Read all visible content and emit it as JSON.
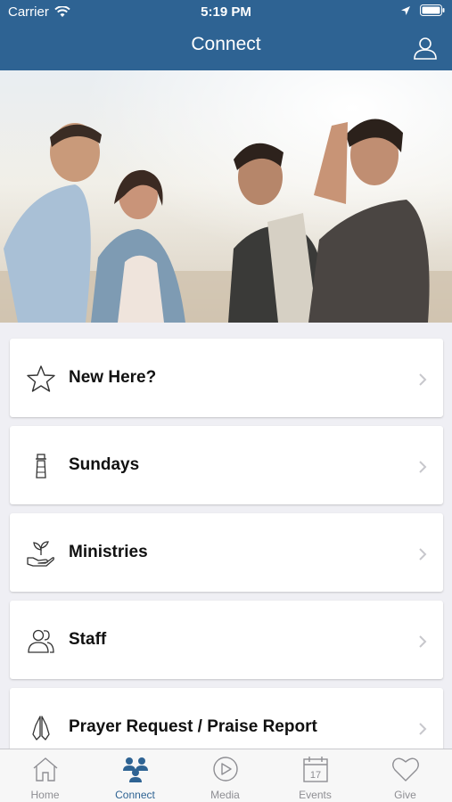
{
  "status_bar": {
    "carrier": "Carrier",
    "time": "5:19 PM"
  },
  "nav": {
    "title": "Connect"
  },
  "colors": {
    "brand": "#2e6393",
    "tab_inactive": "#8e8e93",
    "background": "#efeff4"
  },
  "list": [
    {
      "label": "New Here?",
      "icon": "star-icon"
    },
    {
      "label": "Sundays",
      "icon": "lighthouse-icon"
    },
    {
      "label": "Ministries",
      "icon": "hand-plant-icon"
    },
    {
      "label": "Staff",
      "icon": "people-icon"
    },
    {
      "label": "Prayer Request / Praise Report",
      "icon": "praying-hands-icon"
    }
  ],
  "tabs": [
    {
      "label": "Home",
      "icon": "house-icon",
      "active": false
    },
    {
      "label": "Connect",
      "icon": "group-icon",
      "active": true
    },
    {
      "label": "Media",
      "icon": "play-icon",
      "active": false
    },
    {
      "label": "Events",
      "icon": "calendar-icon",
      "active": false
    },
    {
      "label": "Give",
      "icon": "heart-icon",
      "active": false
    }
  ]
}
